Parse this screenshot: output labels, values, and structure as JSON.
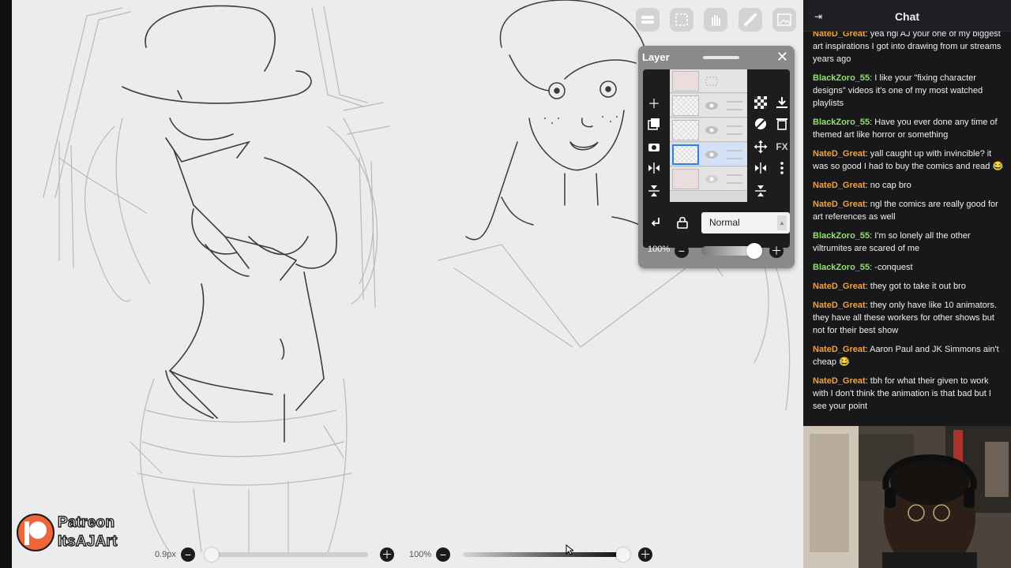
{
  "app": {
    "watermark": {
      "line1": "Patreon",
      "line2": "ItsAJArt"
    }
  },
  "toolbar": {
    "tools": [
      "brush-select-icon",
      "selection-icon",
      "hand-icon",
      "ruler-icon",
      "image-icon"
    ]
  },
  "layer_panel": {
    "title": "Layer",
    "blend_mode": "Normal",
    "opacity_label": "100%",
    "opacity_value": 1.0,
    "selected_layer_index": 3
  },
  "bottom_bar": {
    "brush_size_label": "0.9px",
    "brush_size_fraction": 0.0,
    "opacity_label": "100%",
    "opacity_fraction": 1.0
  },
  "chat": {
    "title": "Chat",
    "colors": {
      "NateD_Great": "#f0a23a",
      "BlackZoro_55": "#8fe36b"
    },
    "messages": [
      {
        "user": "NateD_Great",
        "text": "yea ngl AJ your one of my biggest art inspirations I got into drawing from ur streams years ago"
      },
      {
        "user": "BlackZoro_55",
        "text": "I like your \"fixing character designs\" videos it's one of my most watched playlists"
      },
      {
        "user": "BlackZoro_55",
        "text": "Have you ever done any time of themed art like horror or something"
      },
      {
        "user": "NateD_Great",
        "text": "yall caught up with invincible? it was so good I had to buy the comics and read 😂"
      },
      {
        "user": "NateD_Great",
        "text": "no cap bro"
      },
      {
        "user": "NateD_Great",
        "text": "ngl the comics are really good for art references as well"
      },
      {
        "user": "BlackZoro_55",
        "text": "I'm so lonely all the other viltrumites are scared of me"
      },
      {
        "user": "BlackZoro_55",
        "text": "-conquest"
      },
      {
        "user": "NateD_Great",
        "text": "they got to take it out bro"
      },
      {
        "user": "NateD_Great",
        "text": "they only have like 10 animators. they have all these workers for other shows but not for their best show"
      },
      {
        "user": "NateD_Great",
        "text": "Aaron Paul and JK Simmons ain't cheap 😂"
      },
      {
        "user": "NateD_Great",
        "text": "tbh for what their given to work with I don't think the animation is that bad but I see your point"
      }
    ]
  }
}
